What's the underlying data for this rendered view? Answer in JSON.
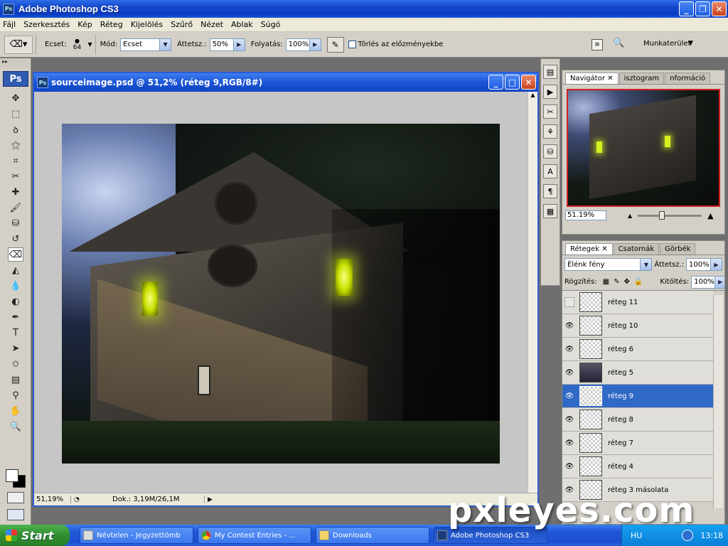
{
  "app": {
    "title": "Adobe Photoshop CS3",
    "icon_label": "Ps"
  },
  "menu": [
    "Fájl",
    "Szerkesztés",
    "Kép",
    "Réteg",
    "Kijelölés",
    "Szűrő",
    "Nézet",
    "Ablak",
    "Súgó"
  ],
  "options": {
    "brush_label": "Ecset:",
    "brush_size": "64",
    "mode_label": "Mód:",
    "mode_value": "Ecset",
    "opacity_label": "Áttetsz.:",
    "opacity_value": "50%",
    "flow_label": "Folyatás:",
    "flow_value": "100%",
    "erase_history_label": "Törlés az előzményekbe",
    "workspace_label": "Munkaterület"
  },
  "toolbox": {
    "logo": "Ps",
    "tools": [
      "move-tool-icon",
      "marquee-tool-icon",
      "lasso-tool-icon",
      "magic-wand-icon",
      "crop-tool-icon",
      "slice-tool-icon",
      "healing-brush-icon",
      "brush-tool-icon",
      "clone-stamp-icon",
      "history-brush-icon",
      "eraser-tool-icon",
      "paint-bucket-icon",
      "blur-tool-icon",
      "dodge-tool-icon",
      "pen-tool-icon",
      "type-tool-icon",
      "path-select-icon",
      "shape-tool-icon",
      "notes-tool-icon",
      "eyedropper-icon",
      "hand-tool-icon",
      "zoom-tool-icon"
    ]
  },
  "document": {
    "title": "sourceimage.psd @ 51,2% (réteg 9,RGB/8#)",
    "zoom": "51,19%",
    "doc_info": "Dok.: 3,19M/26,1M",
    "watermark_text": "pxleyes.com"
  },
  "navigator": {
    "tabs": [
      "Navigátor",
      "isztogram",
      "nformáció"
    ],
    "zoom_value": "51.19%"
  },
  "layers_panel": {
    "tabs": [
      "Rétegek",
      "Csatornák",
      "Görbék"
    ],
    "blend_mode": "Élénk fény",
    "opacity_label": "Áttetsz.:",
    "opacity_value": "100%",
    "lock_label": "Rögzítés:",
    "fill_label": "Kitöltés:",
    "fill_value": "100%",
    "layers": [
      {
        "name": "réteg 11",
        "visible": false,
        "selected": false,
        "image": false
      },
      {
        "name": "réteg 10",
        "visible": true,
        "selected": false,
        "image": false
      },
      {
        "name": "réteg 6",
        "visible": true,
        "selected": false,
        "image": false
      },
      {
        "name": "réteg 5",
        "visible": true,
        "selected": false,
        "image": true
      },
      {
        "name": "réteg 9",
        "visible": true,
        "selected": true,
        "image": false
      },
      {
        "name": "réteg 8",
        "visible": true,
        "selected": false,
        "image": false
      },
      {
        "name": "réteg 7",
        "visible": true,
        "selected": false,
        "image": false
      },
      {
        "name": "réteg 4",
        "visible": true,
        "selected": false,
        "image": false
      },
      {
        "name": "réteg 3 másolata",
        "visible": true,
        "selected": false,
        "image": false
      }
    ]
  },
  "taskbar": {
    "start_label": "Start",
    "tasks": [
      {
        "label": "Névtelen - Jegyzettömb",
        "active": false
      },
      {
        "label": "My Contest Entries - ...",
        "active": false
      },
      {
        "label": "Downloads",
        "active": false
      },
      {
        "label": "Adobe Photoshop CS3",
        "active": true
      }
    ],
    "lang": "HU",
    "clock": "13:18"
  },
  "watermark": "pxleyes.com",
  "colors": {
    "selection": "#3169c6",
    "xp_blue": "#1547c9",
    "window_glow": "#d8f020"
  }
}
